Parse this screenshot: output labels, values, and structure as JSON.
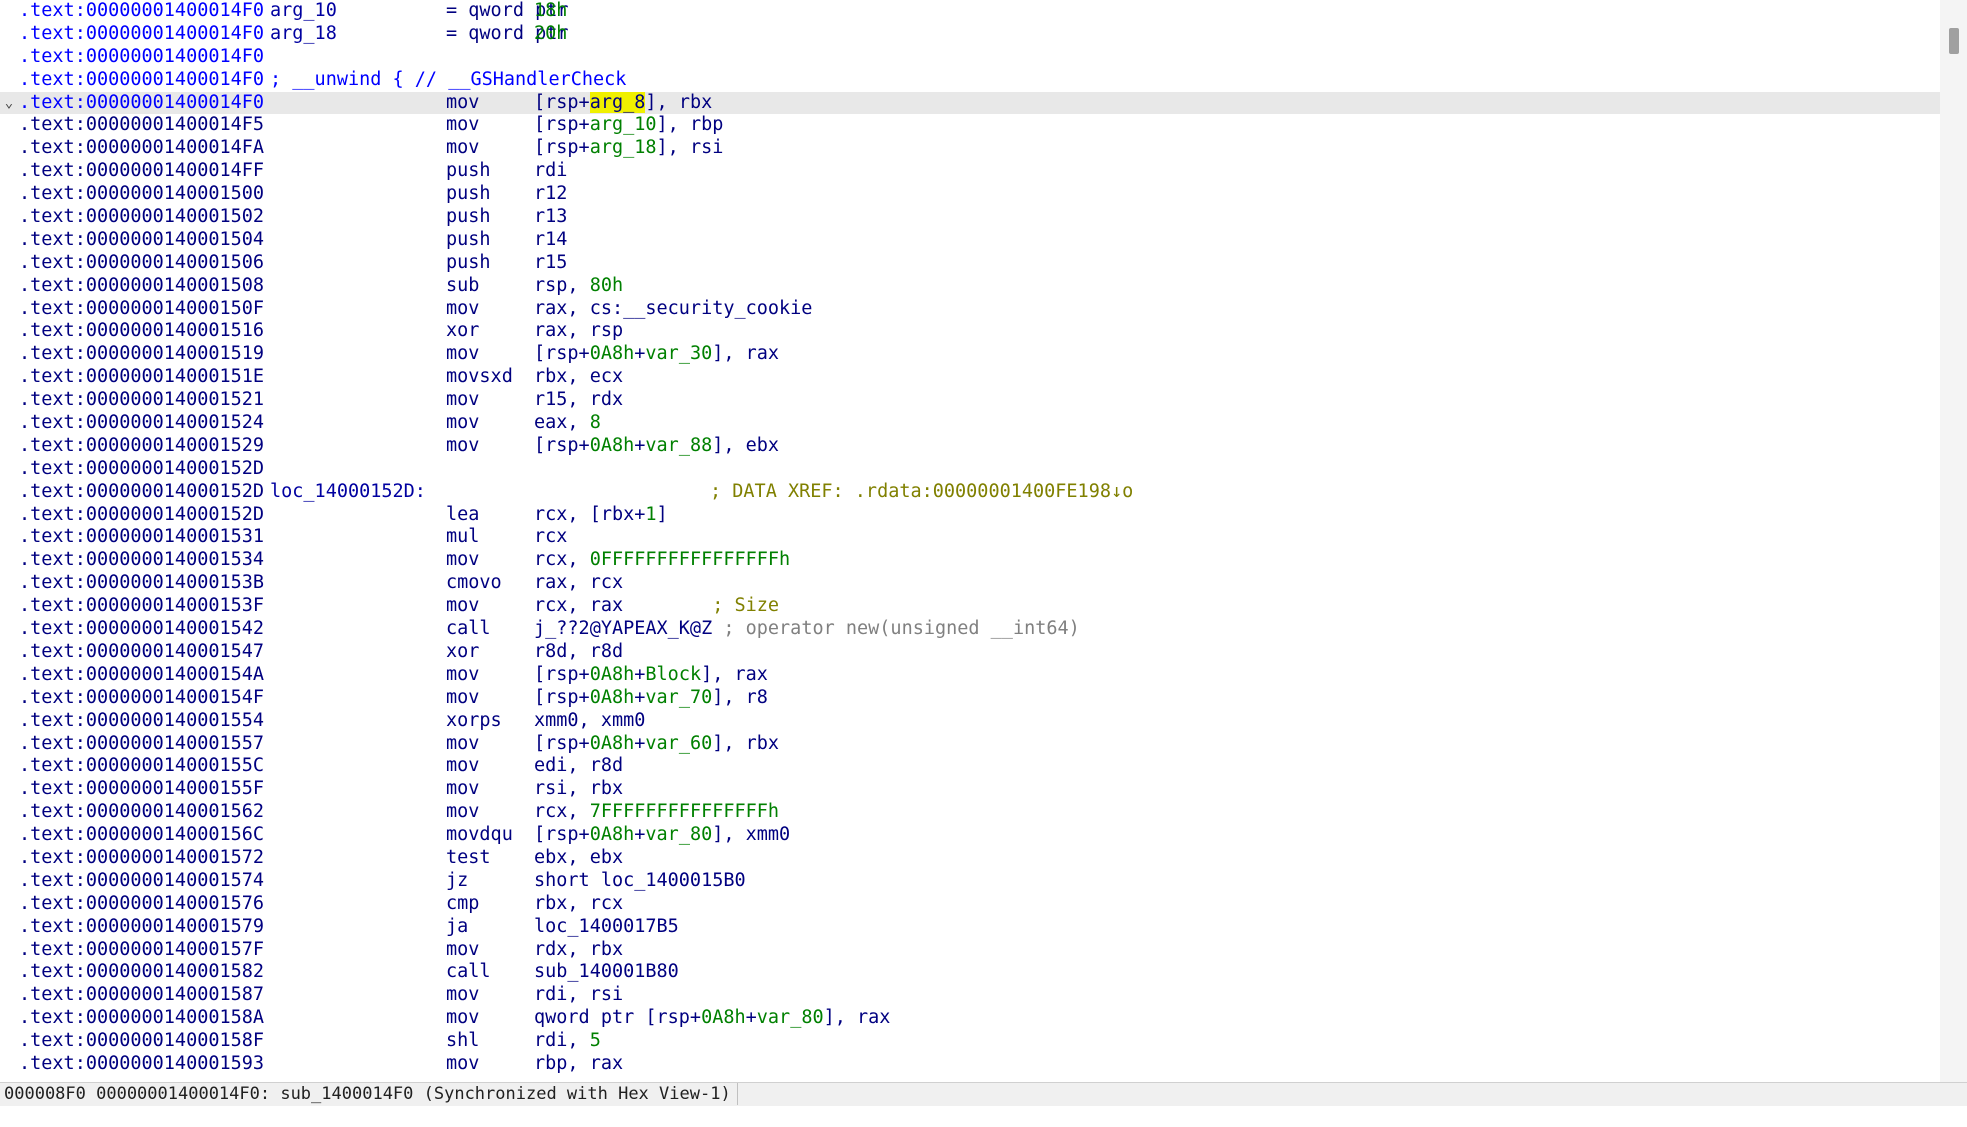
{
  "status_bar": "000008F0 00000001400014F0: sub_1400014F0 (Synchronized with Hex View-1)",
  "lines": [
    {
      "addr": ".text:00000001400014F0",
      "blue": true,
      "label": "arg_10",
      "mnem": "= qword ptr",
      "ops": [
        {
          "t": "18h",
          "c": "num"
        }
      ]
    },
    {
      "addr": ".text:00000001400014F0",
      "blue": true,
      "label": "arg_18",
      "mnem": "= qword ptr",
      "ops": [
        {
          "t": "20h",
          "c": "num"
        }
      ]
    },
    {
      "addr": ".text:00000001400014F0",
      "blue": true
    },
    {
      "addr": ".text:00000001400014F0",
      "blue": true,
      "label": "; __unwind { // __GSHandlerCheck",
      "labelClass": "cmt-blue"
    },
    {
      "addr": ".text:00000001400014F0",
      "blue": true,
      "current": true,
      "fold": "⌄",
      "mnem": "mov",
      "ops": [
        {
          "t": "[rsp+"
        },
        {
          "t": "",
          "c": "cursor"
        },
        {
          "t": "arg_8",
          "c": "hl"
        },
        {
          "t": "], rbx"
        }
      ]
    },
    {
      "addr": ".text:00000001400014F5",
      "mnem": "mov",
      "ops": [
        {
          "t": "[rsp+"
        },
        {
          "t": "arg_10",
          "c": "var"
        },
        {
          "t": "], rbp"
        }
      ]
    },
    {
      "addr": ".text:00000001400014FA",
      "mnem": "mov",
      "ops": [
        {
          "t": "[rsp+"
        },
        {
          "t": "arg_18",
          "c": "var"
        },
        {
          "t": "], rsi"
        }
      ]
    },
    {
      "addr": ".text:00000001400014FF",
      "mnem": "push",
      "ops": [
        {
          "t": "rdi"
        }
      ]
    },
    {
      "addr": ".text:0000000140001500",
      "mnem": "push",
      "ops": [
        {
          "t": "r12"
        }
      ]
    },
    {
      "addr": ".text:0000000140001502",
      "mnem": "push",
      "ops": [
        {
          "t": "r13"
        }
      ]
    },
    {
      "addr": ".text:0000000140001504",
      "mnem": "push",
      "ops": [
        {
          "t": "r14"
        }
      ]
    },
    {
      "addr": ".text:0000000140001506",
      "mnem": "push",
      "ops": [
        {
          "t": "r15"
        }
      ]
    },
    {
      "addr": ".text:0000000140001508",
      "mnem": "sub",
      "ops": [
        {
          "t": "rsp, "
        },
        {
          "t": "80h",
          "c": "num"
        }
      ]
    },
    {
      "addr": ".text:000000014000150F",
      "mnem": "mov",
      "ops": [
        {
          "t": "rax, cs:__security_cookie"
        }
      ]
    },
    {
      "addr": ".text:0000000140001516",
      "mnem": "xor",
      "ops": [
        {
          "t": "rax, rsp"
        }
      ]
    },
    {
      "addr": ".text:0000000140001519",
      "mnem": "mov",
      "ops": [
        {
          "t": "[rsp+"
        },
        {
          "t": "0A8h",
          "c": "num"
        },
        {
          "t": "+"
        },
        {
          "t": "var_30",
          "c": "var"
        },
        {
          "t": "], rax"
        }
      ]
    },
    {
      "addr": ".text:000000014000151E",
      "mnem": "movsxd",
      "ops": [
        {
          "t": "rbx, ecx"
        }
      ]
    },
    {
      "addr": ".text:0000000140001521",
      "mnem": "mov",
      "ops": [
        {
          "t": "r15, rdx"
        }
      ]
    },
    {
      "addr": ".text:0000000140001524",
      "mnem": "mov",
      "ops": [
        {
          "t": "eax, "
        },
        {
          "t": "8",
          "c": "num"
        }
      ]
    },
    {
      "addr": ".text:0000000140001529",
      "mnem": "mov",
      "ops": [
        {
          "t": "[rsp+"
        },
        {
          "t": "0A8h",
          "c": "num"
        },
        {
          "t": "+"
        },
        {
          "t": "var_88",
          "c": "var"
        },
        {
          "t": "], ebx"
        }
      ]
    },
    {
      "addr": ".text:000000014000152D"
    },
    {
      "addr": ".text:000000014000152D",
      "label": "loc_14000152D:",
      "xref": "; DATA XREF: .rdata:00000001400FE198↓o"
    },
    {
      "addr": ".text:000000014000152D",
      "mnem": "lea",
      "ops": [
        {
          "t": "rcx, [rbx+"
        },
        {
          "t": "1",
          "c": "num"
        },
        {
          "t": "]"
        }
      ]
    },
    {
      "addr": ".text:0000000140001531",
      "mnem": "mul",
      "ops": [
        {
          "t": "rcx"
        }
      ]
    },
    {
      "addr": ".text:0000000140001534",
      "mnem": "mov",
      "ops": [
        {
          "t": "rcx, "
        },
        {
          "t": "0FFFFFFFFFFFFFFFFh",
          "c": "num"
        }
      ]
    },
    {
      "addr": ".text:000000014000153B",
      "mnem": "cmovo",
      "ops": [
        {
          "t": "rax, rcx"
        }
      ]
    },
    {
      "addr": ".text:000000014000153F",
      "mnem": "mov",
      "ops": [
        {
          "t": "rcx, rax        "
        },
        {
          "t": "; Size",
          "c": "xref-inline"
        }
      ]
    },
    {
      "addr": ".text:0000000140001542",
      "mnem": "call",
      "ops": [
        {
          "t": "j_??2@YAPEAX_K@Z"
        },
        {
          "t": " ; operator new(unsigned __int64)",
          "c": "cmt"
        }
      ]
    },
    {
      "addr": ".text:0000000140001547",
      "mnem": "xor",
      "ops": [
        {
          "t": "r8d, r8d"
        }
      ]
    },
    {
      "addr": ".text:000000014000154A",
      "mnem": "mov",
      "ops": [
        {
          "t": "[rsp+"
        },
        {
          "t": "0A8h",
          "c": "num"
        },
        {
          "t": "+"
        },
        {
          "t": "Block",
          "c": "var"
        },
        {
          "t": "], rax"
        }
      ]
    },
    {
      "addr": ".text:000000014000154F",
      "mnem": "mov",
      "ops": [
        {
          "t": "[rsp+"
        },
        {
          "t": "0A8h",
          "c": "num"
        },
        {
          "t": "+"
        },
        {
          "t": "var_70",
          "c": "var"
        },
        {
          "t": "], r8"
        }
      ]
    },
    {
      "addr": ".text:0000000140001554",
      "mnem": "xorps",
      "ops": [
        {
          "t": "xmm0, xmm0"
        }
      ]
    },
    {
      "addr": ".text:0000000140001557",
      "mnem": "mov",
      "ops": [
        {
          "t": "[rsp+"
        },
        {
          "t": "0A8h",
          "c": "num"
        },
        {
          "t": "+"
        },
        {
          "t": "var_60",
          "c": "var"
        },
        {
          "t": "], rbx"
        }
      ]
    },
    {
      "addr": ".text:000000014000155C",
      "mnem": "mov",
      "ops": [
        {
          "t": "edi, r8d"
        }
      ]
    },
    {
      "addr": ".text:000000014000155F",
      "mnem": "mov",
      "ops": [
        {
          "t": "rsi, rbx"
        }
      ]
    },
    {
      "addr": ".text:0000000140001562",
      "mnem": "mov",
      "ops": [
        {
          "t": "rcx, "
        },
        {
          "t": "7FFFFFFFFFFFFFFFh",
          "c": "num"
        }
      ]
    },
    {
      "addr": ".text:000000014000156C",
      "mnem": "movdqu",
      "ops": [
        {
          "t": "[rsp+"
        },
        {
          "t": "0A8h",
          "c": "num"
        },
        {
          "t": "+"
        },
        {
          "t": "var_80",
          "c": "var"
        },
        {
          "t": "], xmm0"
        }
      ]
    },
    {
      "addr": ".text:0000000140001572",
      "mnem": "test",
      "ops": [
        {
          "t": "ebx, ebx"
        }
      ]
    },
    {
      "addr": ".text:0000000140001574",
      "mnem": "jz",
      "ops": [
        {
          "t": "short loc_1400015B0"
        }
      ]
    },
    {
      "addr": ".text:0000000140001576",
      "mnem": "cmp",
      "ops": [
        {
          "t": "rbx, rcx"
        }
      ]
    },
    {
      "addr": ".text:0000000140001579",
      "mnem": "ja",
      "ops": [
        {
          "t": "loc_1400017B5"
        }
      ]
    },
    {
      "addr": ".text:000000014000157F",
      "mnem": "mov",
      "ops": [
        {
          "t": "rdx, rbx"
        }
      ]
    },
    {
      "addr": ".text:0000000140001582",
      "mnem": "call",
      "ops": [
        {
          "t": "sub_140001B80"
        }
      ]
    },
    {
      "addr": ".text:0000000140001587",
      "mnem": "mov",
      "ops": [
        {
          "t": "rdi, rsi"
        }
      ]
    },
    {
      "addr": ".text:000000014000158A",
      "mnem": "mov",
      "ops": [
        {
          "t": "qword ptr [rsp+"
        },
        {
          "t": "0A8h",
          "c": "num"
        },
        {
          "t": "+"
        },
        {
          "t": "var_80",
          "c": "var"
        },
        {
          "t": "], rax"
        }
      ]
    },
    {
      "addr": ".text:000000014000158F",
      "mnem": "shl",
      "ops": [
        {
          "t": "rdi, "
        },
        {
          "t": "5",
          "c": "num"
        }
      ]
    },
    {
      "addr": ".text:0000000140001593",
      "mnem": "mov",
      "ops": [
        {
          "t": "rbp, rax"
        }
      ]
    }
  ]
}
